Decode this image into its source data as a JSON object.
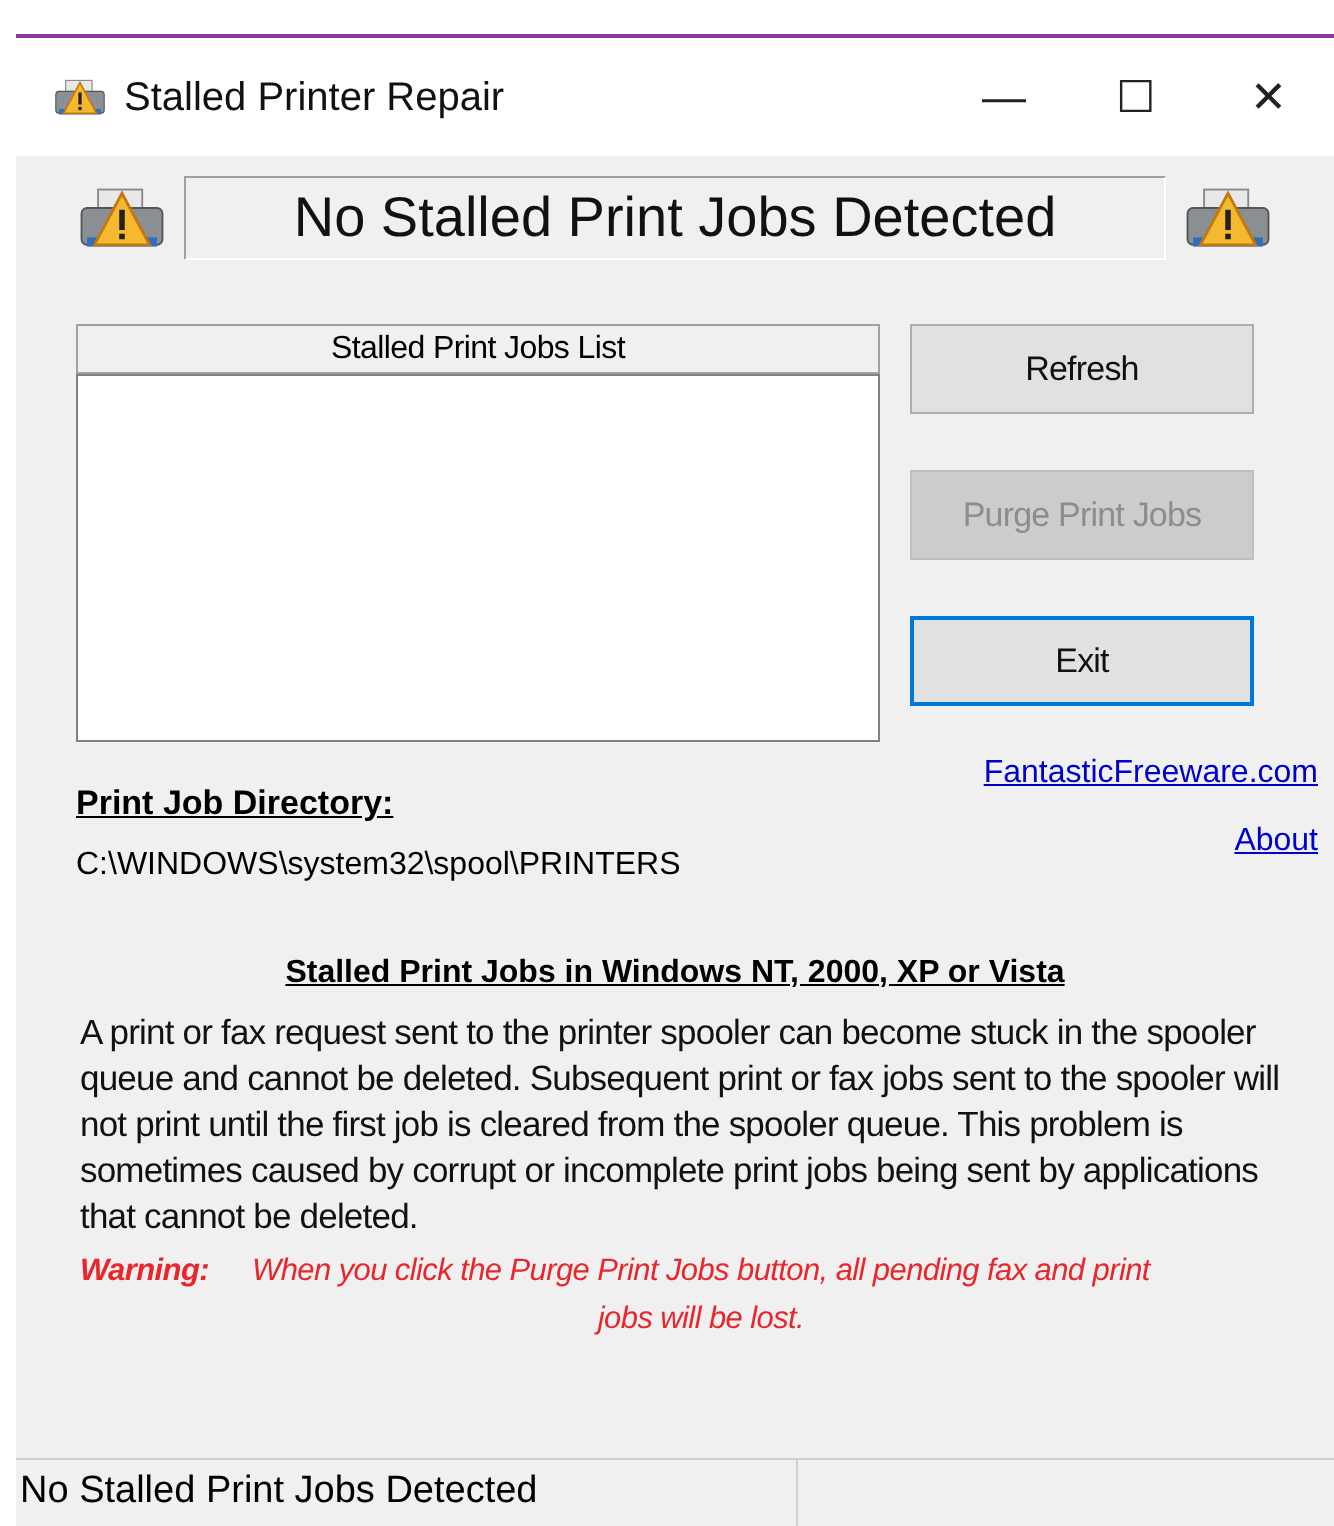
{
  "window": {
    "title": "Stalled Printer Repair",
    "controls": [
      "—",
      "☐",
      "✕"
    ]
  },
  "banner": {
    "status": "No Stalled Print Jobs Detected"
  },
  "job_list": {
    "header": "Stalled Print Jobs List"
  },
  "buttons": [
    {
      "label": "Refresh",
      "disabled": false,
      "focused": false
    },
    {
      "label": "Purge Print Jobs",
      "disabled": true,
      "focused": false
    },
    {
      "label": "Exit",
      "disabled": false,
      "focused": true
    }
  ],
  "links": [
    "FantasticFreeware.com",
    "About"
  ],
  "directory": {
    "label": "Print Job Directory:",
    "path": "C:\\WINDOWS\\system32\\spool\\PRINTERS"
  },
  "info": {
    "heading": "Stalled Print Jobs in Windows NT, 2000, XP or Vista",
    "body": "A print or fax request sent to the printer spooler can become stuck in the spooler queue and cannot be deleted. Subsequent print or fax jobs sent to the spooler will not print until the first job is cleared from the spooler queue. This problem is sometimes caused by corrupt or incomplete print jobs being sent by applications that cannot be deleted.",
    "warning_label": "Warning:",
    "warning": "When you click the Purge Print Jobs button, all pending fax and print jobs will be lost."
  },
  "status_bar": {
    "text": "No Stalled Print Jobs Detected"
  }
}
